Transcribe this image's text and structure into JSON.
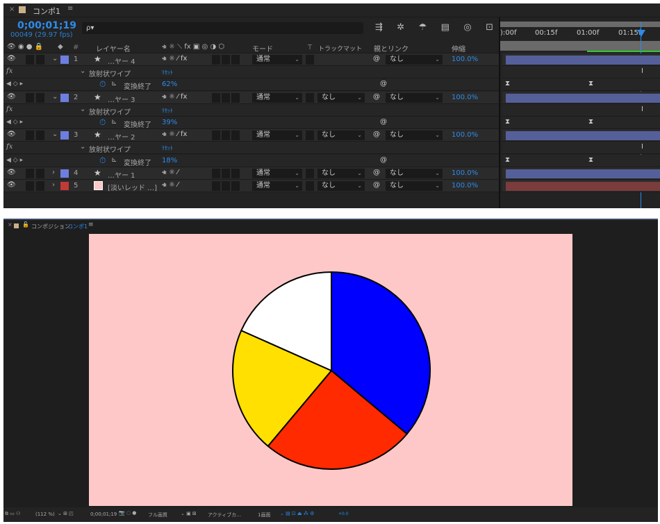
{
  "timeline": {
    "tab_title": "コンポ1",
    "timecode": "0;00;01;19",
    "frame_info": "00049 (29.97 fps)",
    "search_placeholder": "ρ▾",
    "headers": {
      "num": "#",
      "layer_name": "レイヤー名",
      "mode": "モード",
      "t": "T",
      "track_matte": "トラックマット",
      "parent": "親とリンク",
      "stretch": "伸縮"
    },
    "ruler": [
      "):00f",
      "00:15f",
      "01:00f",
      "01:15f"
    ],
    "layers": [
      {
        "num": "1",
        "name": "…ヤー 4",
        "mode": "通常",
        "matte": "",
        "parent": "なし",
        "stretch": "100.0%",
        "color": "#6c7fe0",
        "expanded": true,
        "fx": true,
        "effect": "放射状ワイプ",
        "reset": "ﾘｾｯﾄ",
        "prop": "変換終了",
        "value": "62%"
      },
      {
        "num": "2",
        "name": "…ヤー 3",
        "mode": "通常",
        "matte": "なし",
        "parent": "なし",
        "stretch": "100.0%",
        "color": "#6c7fe0",
        "expanded": true,
        "fx": true,
        "effect": "放射状ワイプ",
        "reset": "ﾘｾｯﾄ",
        "prop": "変換終了",
        "value": "39%"
      },
      {
        "num": "3",
        "name": "…ヤー 2",
        "mode": "通常",
        "matte": "なし",
        "parent": "なし",
        "stretch": "100.0%",
        "color": "#6c7fe0",
        "expanded": true,
        "fx": true,
        "effect": "放射状ワイプ",
        "reset": "ﾘｾｯﾄ",
        "prop": "変換終了",
        "value": "18%"
      },
      {
        "num": "4",
        "name": "…ヤー 1",
        "mode": "通常",
        "matte": "なし",
        "parent": "なし",
        "stretch": "100.0%",
        "color": "#6c7fe0",
        "expanded": false,
        "fx": false
      },
      {
        "num": "5",
        "name": "[淡いレッド …]",
        "mode": "通常",
        "matte": "なし",
        "parent": "なし",
        "stretch": "100.0%",
        "color": "#c03a3a",
        "expanded": false,
        "fx": false
      }
    ]
  },
  "composition": {
    "panel_label": "コンポジション",
    "comp_name": "コンポ1",
    "background": "#ffc8c8",
    "pie": [
      {
        "name": "blue",
        "color": "#0000ff",
        "start": 0,
        "end": 130
      },
      {
        "name": "red",
        "color": "#ff2a00",
        "start": 130,
        "end": 220
      },
      {
        "name": "yellow",
        "color": "#ffe000",
        "start": 220,
        "end": 294
      },
      {
        "name": "white",
        "color": "#ffffff",
        "start": 294,
        "end": 360
      }
    ],
    "toolbar": {
      "zoom": "(112 %)",
      "timecode": "0;00;01;19",
      "quality": "フル画質",
      "camera": "アクティブカ…",
      "views": "1画面",
      "exposure": "+0.0"
    }
  }
}
